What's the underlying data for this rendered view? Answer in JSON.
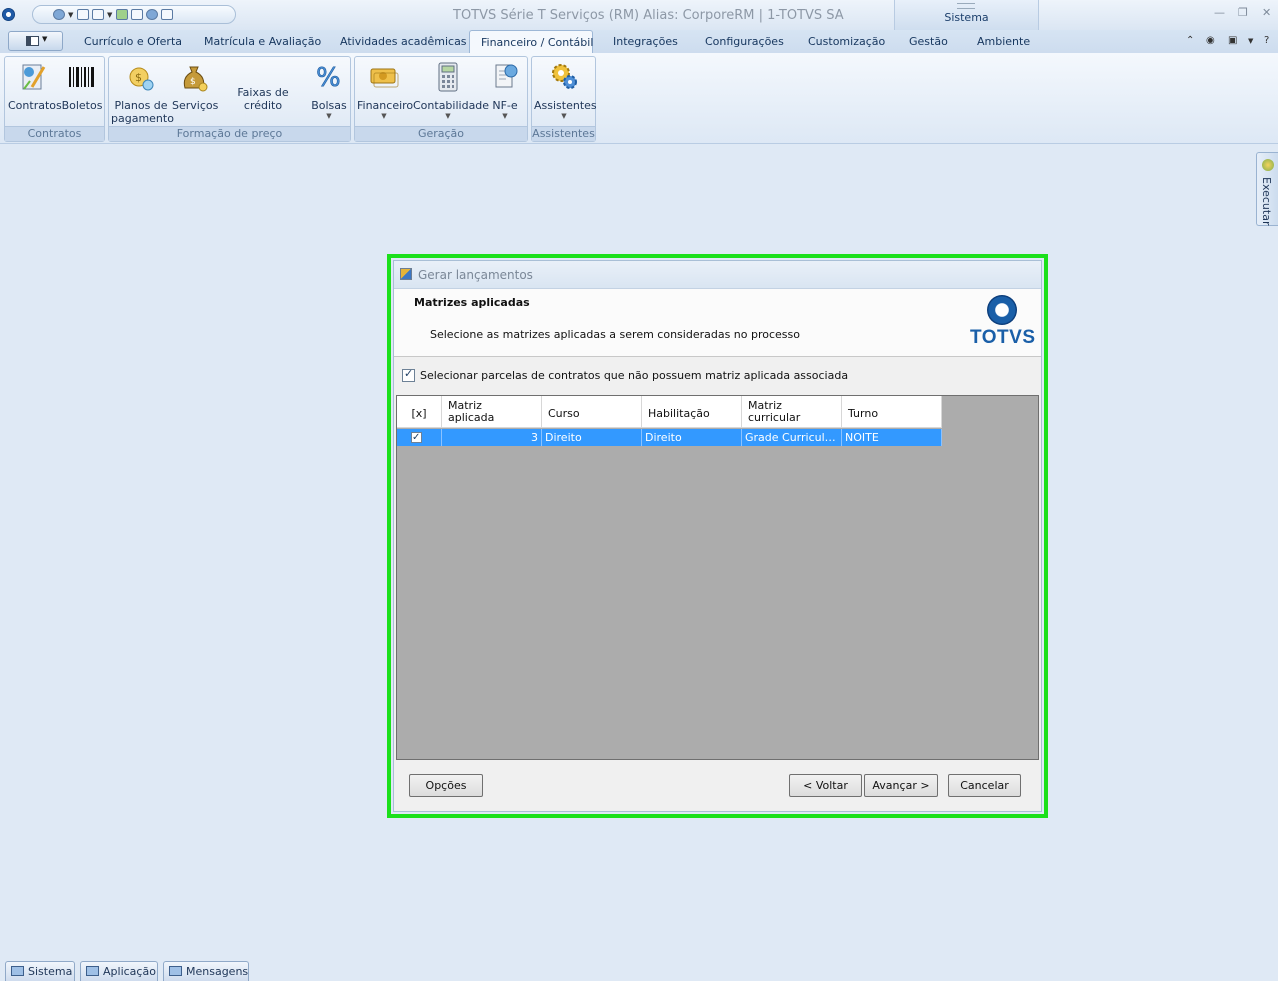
{
  "window": {
    "title": "TOTVS Série T Serviços (RM) Alias: CorporeRM | 1-TOTVS SA",
    "context_tab_group": "Sistema"
  },
  "tabs": [
    {
      "label": "Currículo e Oferta"
    },
    {
      "label": "Matrícula e Avaliação"
    },
    {
      "label": "Atividades acadêmicas"
    },
    {
      "label": "Financeiro / Contábil",
      "active": true
    },
    {
      "label": "Integrações"
    },
    {
      "label": "Configurações"
    },
    {
      "label": "Customização"
    },
    {
      "label": "Gestão"
    },
    {
      "label": "Ambiente"
    }
  ],
  "ribbon": {
    "contratos_group": {
      "label": "Contratos",
      "contratos": "Contratos",
      "boletos": "Boletos"
    },
    "formacao_group": {
      "label": "Formação de preço",
      "planos_line1": "Planos de",
      "planos_line2": "pagamento",
      "servicos": "Serviços",
      "faixas": "Faixas de crédito",
      "bolsas": "Bolsas"
    },
    "geracao_group": {
      "label": "Geração",
      "financeiro": "Financeiro",
      "contabilidade": "Contabilidade",
      "nfe": "NF-e"
    },
    "assistentes_group": {
      "label": "Assistentes",
      "assistentes": "Assistentes"
    }
  },
  "side_panel": {
    "execute": "Executar"
  },
  "dialog": {
    "title": "Gerar lançamentos",
    "step_title": "Matrizes aplicadas",
    "step_description": "Selecione as matrizes aplicadas a serem consideradas no processo",
    "logo_text": "TOTVS",
    "include_orphans_label": "Selecionar parcelas de contratos que não possuem matriz aplicada associada",
    "include_orphans_checked": true,
    "grid": {
      "columns": [
        {
          "line1": "[x]",
          "line2": ""
        },
        {
          "line1": "Matriz",
          "line2": "aplicada"
        },
        {
          "line1": "Curso",
          "line2": ""
        },
        {
          "line1": "Habilitação",
          "line2": ""
        },
        {
          "line1": "Matriz",
          "line2": "curricular"
        },
        {
          "line1": "Turno",
          "line2": ""
        }
      ],
      "rows": [
        {
          "checked": true,
          "matriz_aplicada": "3",
          "curso": "Direito",
          "habilitacao": "Direito",
          "matriz_curricular": "Grade Curricular...",
          "turno": "NOITE"
        }
      ]
    },
    "buttons": {
      "options": "Opções",
      "back": "< Voltar",
      "next": "Avançar >",
      "cancel": "Cancelar"
    }
  },
  "taskbar": {
    "sistema": "Sistema",
    "aplicacao": "Aplicação",
    "mensagens": "Mensagens"
  },
  "colors": {
    "highlight": "#1be01b",
    "selection": "#3399ff",
    "brand": "#1a5fa8"
  }
}
